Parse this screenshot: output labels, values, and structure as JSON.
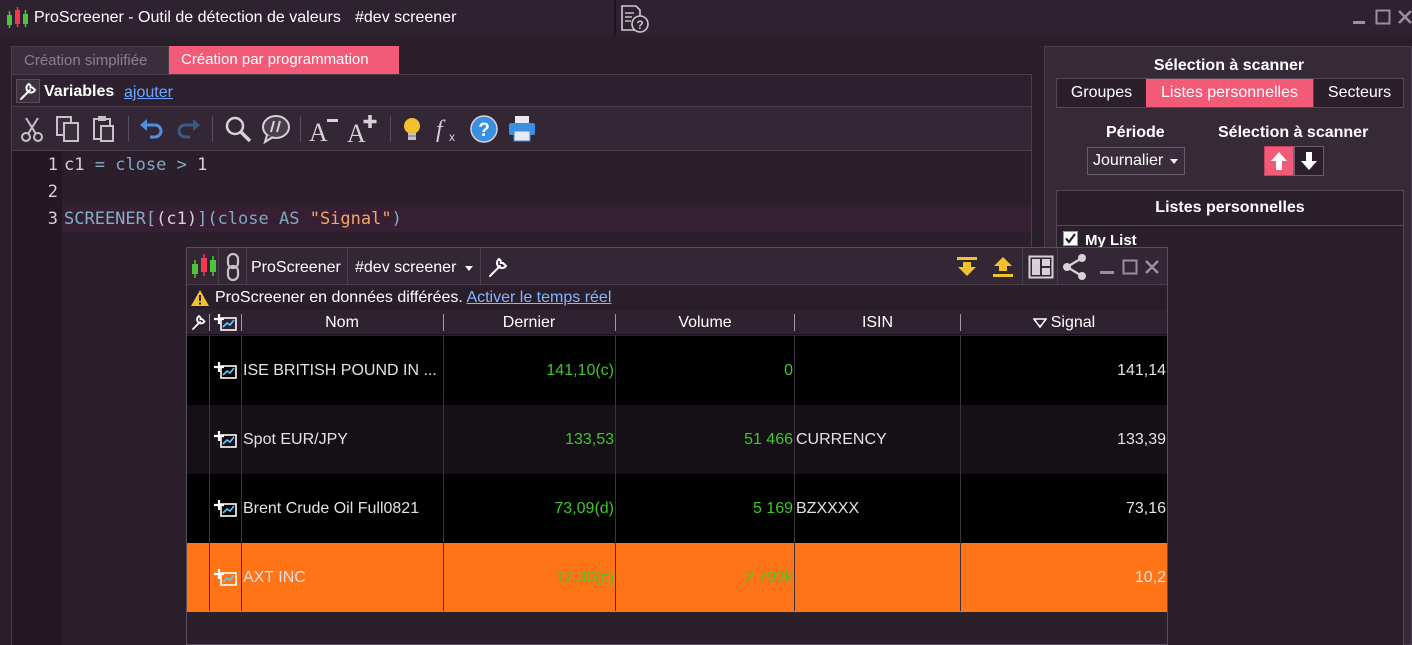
{
  "window": {
    "title": "ProScreener - Outil de détection de valeurs",
    "subtitle": "#dev screener"
  },
  "editor": {
    "tabs": [
      "Création simplifiée",
      "Création par programmation"
    ],
    "active_tab": 1,
    "variables_label": "Variables",
    "add_link": "ajouter",
    "code_lines": [
      {
        "num": "1",
        "text": "c1 = close > 1"
      },
      {
        "num": "2",
        "text": ""
      },
      {
        "num": "3",
        "text": "SCREENER[(c1)](close AS \"Signal\")"
      }
    ]
  },
  "right_panel": {
    "heading": "Sélection à scanner",
    "tabs": [
      "Groupes",
      "Listes personnelles",
      "Secteurs"
    ],
    "active_tab": 1,
    "periode_label": "Période",
    "selection_label": "Sélection à scanner",
    "periode_value": "Journalier",
    "lists_heading": "Listes personnelles",
    "list_item": "My List",
    "list_item_checked": true
  },
  "screener": {
    "title": "ProScreener",
    "selector": "#dev screener",
    "warning_text": "ProScreener en données différées.",
    "warning_link": "Activer le temps réel",
    "columns": [
      "Nom",
      "Dernier",
      "Volume",
      "ISIN",
      "Signal"
    ],
    "sort_column": "Signal",
    "rows": [
      {
        "name": "ISE BRITISH POUND IN ...",
        "last": "141,10(c)",
        "volume": "0",
        "isin": "",
        "signal": "141,14"
      },
      {
        "name": "Spot EUR/JPY",
        "last": "133,53",
        "volume": "51 466",
        "isin": "CURRENCY",
        "signal": "133,39"
      },
      {
        "name": "Brent Crude Oil Full0821",
        "last": "73,09(d)",
        "volume": "5 169",
        "isin": "BZXXXX",
        "signal": "73,16"
      },
      {
        "name": "AXT INC",
        "last": "12,30(c)",
        "volume": "2 792k",
        "isin": "",
        "signal": "10,2"
      }
    ],
    "selected_row": 3
  },
  "colors": {
    "accent": "#f25a78",
    "highlight": "#ff7417",
    "positive": "#3ec82a",
    "link": "#6fa8ff"
  }
}
